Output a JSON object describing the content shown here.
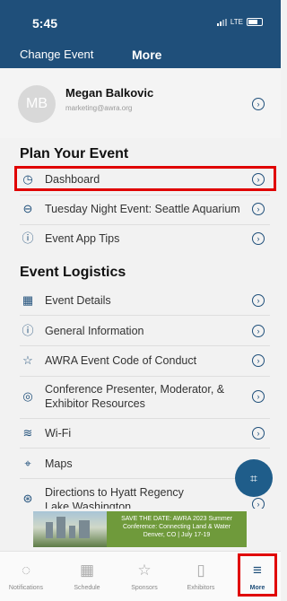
{
  "status_bar": {
    "time": "5:45",
    "network": "LTE"
  },
  "nav": {
    "left": "Change Event",
    "title": "More"
  },
  "profile": {
    "initials": "MB",
    "name": "Megan Balkovic",
    "email": "marketing@awra.org"
  },
  "sections": {
    "plan": {
      "title": "Plan Your Event",
      "items": [
        {
          "label": "Dashboard",
          "icon": "dashboard-icon"
        },
        {
          "label": "Tuesday Night Event: Seattle Aquarium",
          "icon": "car-icon"
        },
        {
          "label": "Event App Tips",
          "icon": "info-icon"
        }
      ]
    },
    "logistics": {
      "title": "Event Logistics",
      "items": [
        {
          "label": "Event Details",
          "icon": "calendar-icon"
        },
        {
          "label": "General Information",
          "icon": "info-icon"
        },
        {
          "label": "AWRA Event Code of Conduct",
          "icon": "star-icon"
        },
        {
          "label": "Conference Presenter, Moderator, &",
          "label2": "Exhibitor Resources",
          "icon": "location-pin-icon"
        },
        {
          "label": "Wi-Fi",
          "icon": "wifi-icon"
        },
        {
          "label": "Maps",
          "icon": "map-icon"
        },
        {
          "label": "Directions to Hyatt Regency",
          "label2": "Lake Washington",
          "icon": "directions-icon"
        }
      ]
    }
  },
  "banner": {
    "line1": "SAVE THE DATE: AWRA 2023 Summer",
    "line2": "Conference: Connecting Land & Water",
    "line3": "Denver, CO | July 17-19"
  },
  "tabs": [
    {
      "label": "Notifications",
      "icon": "bell-icon"
    },
    {
      "label": "Schedule",
      "icon": "calendar-icon"
    },
    {
      "label": "Sponsors",
      "icon": "star-icon"
    },
    {
      "label": "Exhibitors",
      "icon": "document-icon"
    },
    {
      "label": "More",
      "icon": "menu-icon"
    }
  ],
  "colors": {
    "brand": "#1f4f7a",
    "highlight": "#e00000"
  }
}
